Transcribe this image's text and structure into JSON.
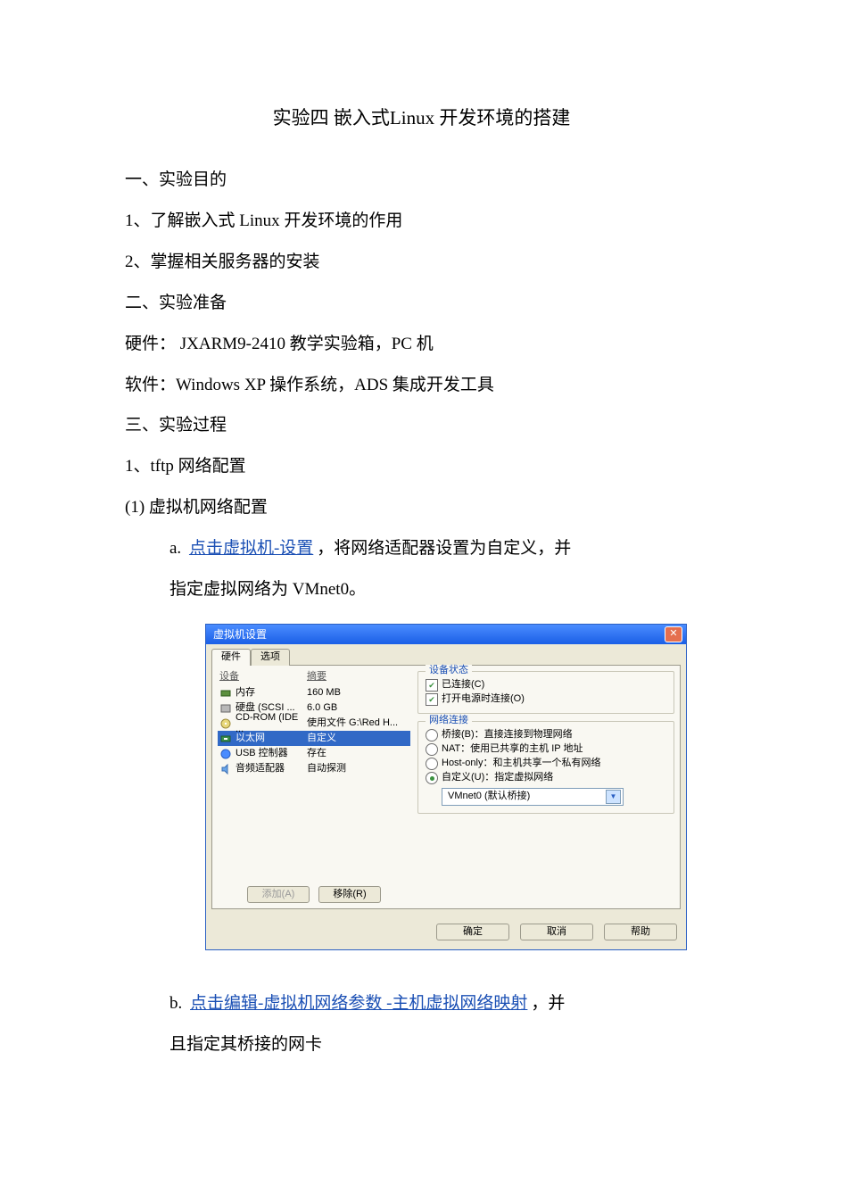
{
  "title": "实验四 嵌入式Linux 开发环境的搭建",
  "s1": "一、实验目的",
  "s1_1": "1、了解嵌入式 Linux 开发环境的作用",
  "s1_2": "2、掌握相关服务器的安装",
  "s2": "二、实验准备",
  "s2_hw": "硬件：  JXARM9-2410 教学实验箱，PC 机",
  "s2_sw": "软件：Windows XP 操作系统，ADS 集成开发工具",
  "s3": "三、实验过程",
  "s3_1": "1、tftp 网络配置",
  "s3_1_1": "(1)  虚拟机网络配置",
  "a_prefix": "a.   ",
  "a_link": "点击虚拟机-设置",
  "a_suffix1": "，将网络适配器设置为自定义，并",
  "a_suffix2": "指定虚拟网络为 VMnet0。",
  "b_prefix": "b.   ",
  "b_link": "点击编辑-虚拟机网络参数 -主机虚拟网络映射",
  "b_suffix1": "，并",
  "b_suffix2": "且指定其桥接的网卡",
  "dlg": {
    "title": "虚拟机设置",
    "tab_hw": "硬件",
    "tab_opt": "选项",
    "hdr_device": "设备",
    "hdr_summary": "摘要",
    "rows": [
      {
        "name": "内存",
        "sum": "160 MB"
      },
      {
        "name": "硬盘 (SCSI ...",
        "sum": "6.0 GB"
      },
      {
        "name": "CD-ROM (IDE ...",
        "sum": "使用文件 G:\\Red H..."
      },
      {
        "name": "以太网",
        "sum": "自定义"
      },
      {
        "name": "USB 控制器",
        "sum": "存在"
      },
      {
        "name": "音频适配器",
        "sum": "自动探测"
      }
    ],
    "btn_add": "添加(A)",
    "btn_remove": "移除(R)",
    "grp_status": "设备状态",
    "chk_connected": "已连接(C)",
    "chk_power": "打开电源时连接(O)",
    "grp_net": "网络连接",
    "r_bridge": "桥接(B)：直接连接到物理网络",
    "r_nat": "NAT：使用已共享的主机 IP 地址",
    "r_host": "Host-only：和主机共享一个私有网络",
    "r_custom": "自定义(U)：指定虚拟网络",
    "sel_value": "VMnet0 (默认桥接)",
    "btn_ok": "确定",
    "btn_cancel": "取消",
    "btn_help": "帮助"
  }
}
